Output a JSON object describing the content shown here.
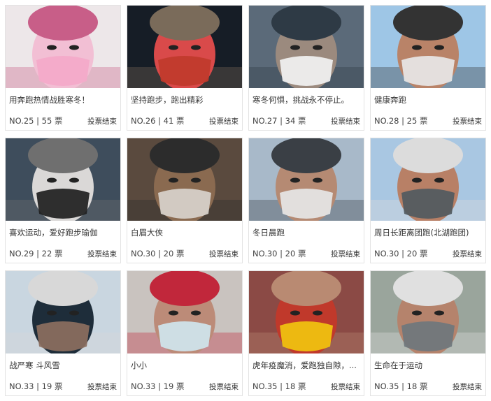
{
  "cards": [
    {
      "title": "用奔跑热情战胜寒冬！",
      "no": "NO.25 | 55 票",
      "status": "投票结束",
      "colors": [
        "#ede7e9",
        "#f2bfd4",
        "#f4a9c9",
        "#c85e88"
      ]
    },
    {
      "title": "坚持跑步，跑出精彩",
      "no": "NO.26 | 41 票",
      "status": "投票结束",
      "colors": [
        "#161d26",
        "#d94a4a",
        "#c0392b",
        "#7a6b5a"
      ]
    },
    {
      "title": "寒冬何惧，挑战永不停止。",
      "no": "NO.27 | 34 票",
      "status": "投票结束",
      "colors": [
        "#5b6a79",
        "#9b8a7e",
        "#f2f2f2",
        "#2e3a45"
      ]
    },
    {
      "title": "健康奔跑",
      "no": "NO.28 | 25 票",
      "status": "投票结束",
      "colors": [
        "#9ec6e6",
        "#b98368",
        "#e7e7e7",
        "#333"
      ]
    },
    {
      "title": "喜欢运动，爱好跑步瑜伽",
      "no": "NO.29 | 22 票",
      "status": "投票结束",
      "colors": [
        "#3e4d5c",
        "#dad8d7",
        "#1f1f1f",
        "#6f6f6f"
      ]
    },
    {
      "title": "白眉大侠",
      "no": "NO.30 | 20 票",
      "status": "投票结束",
      "colors": [
        "#5a4a3e",
        "#8a6a50",
        "#d8d2cc",
        "#2c2c2c"
      ]
    },
    {
      "title": "冬日晨跑",
      "no": "NO.30 | 20 票",
      "status": "投票结束",
      "colors": [
        "#a8b9c9",
        "#b58a73",
        "#e6e6e6",
        "#3a3f45"
      ]
    },
    {
      "title": "周日长距离团跑(北湖跑团)",
      "no": "NO.30 | 20 票",
      "status": "投票结束",
      "colors": [
        "#a9c7e2",
        "#b88066",
        "#505a60",
        "#dcdcdc"
      ]
    },
    {
      "title": "战严寒 斗风雪",
      "no": "NO.33 | 19 票",
      "status": "投票结束",
      "colors": [
        "#c9d6e0",
        "#1e2d3a",
        "#8c6f5f",
        "#d8d8d8"
      ]
    },
    {
      "title": "小小",
      "no": "NO.33 | 19 票",
      "status": "投票结束",
      "colors": [
        "#c9c3bf",
        "#bc8b78",
        "#cfe5ee",
        "#c1273b"
      ]
    },
    {
      "title": "虎年疫魔消，爱跑独自隙，...",
      "no": "NO.35 | 18 票",
      "status": "投票结束",
      "colors": [
        "#8b4a45",
        "#c0392b",
        "#f1c40f",
        "#b98a72"
      ]
    },
    {
      "title": "生命在于运动",
      "no": "NO.35 | 18 票",
      "status": "投票结束",
      "colors": [
        "#9aa59c",
        "#b5836c",
        "#6f777d",
        "#e0e0e0"
      ]
    }
  ]
}
